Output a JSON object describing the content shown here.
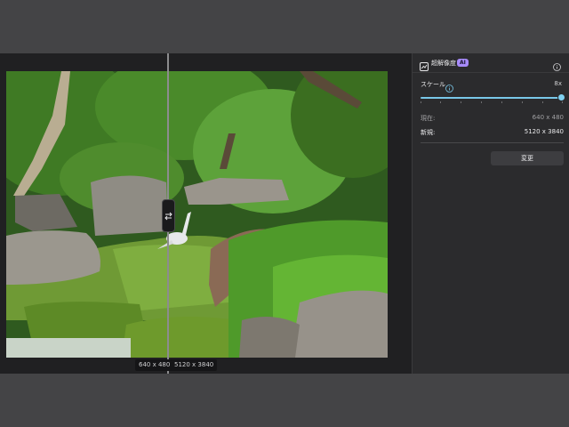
{
  "panel": {
    "title": "超解像度",
    "ai_badge": "AI",
    "scale_label": "スケール",
    "scale_value": "8x",
    "scale_level": 1.0,
    "current_label": "現在:",
    "current_value": "640 x 480",
    "new_label": "新規:",
    "new_value": "5120 x 3840",
    "save_label": "変更"
  },
  "compare": {
    "left_size": "640 x 480",
    "right_size": "5120 x 3840"
  },
  "colors": {
    "accent": "#79c7e8",
    "badge": "#a78bfa"
  },
  "icons": {
    "header": "super-resolution-icon",
    "info": "info-icon",
    "handle": "swap-arrows-icon"
  }
}
